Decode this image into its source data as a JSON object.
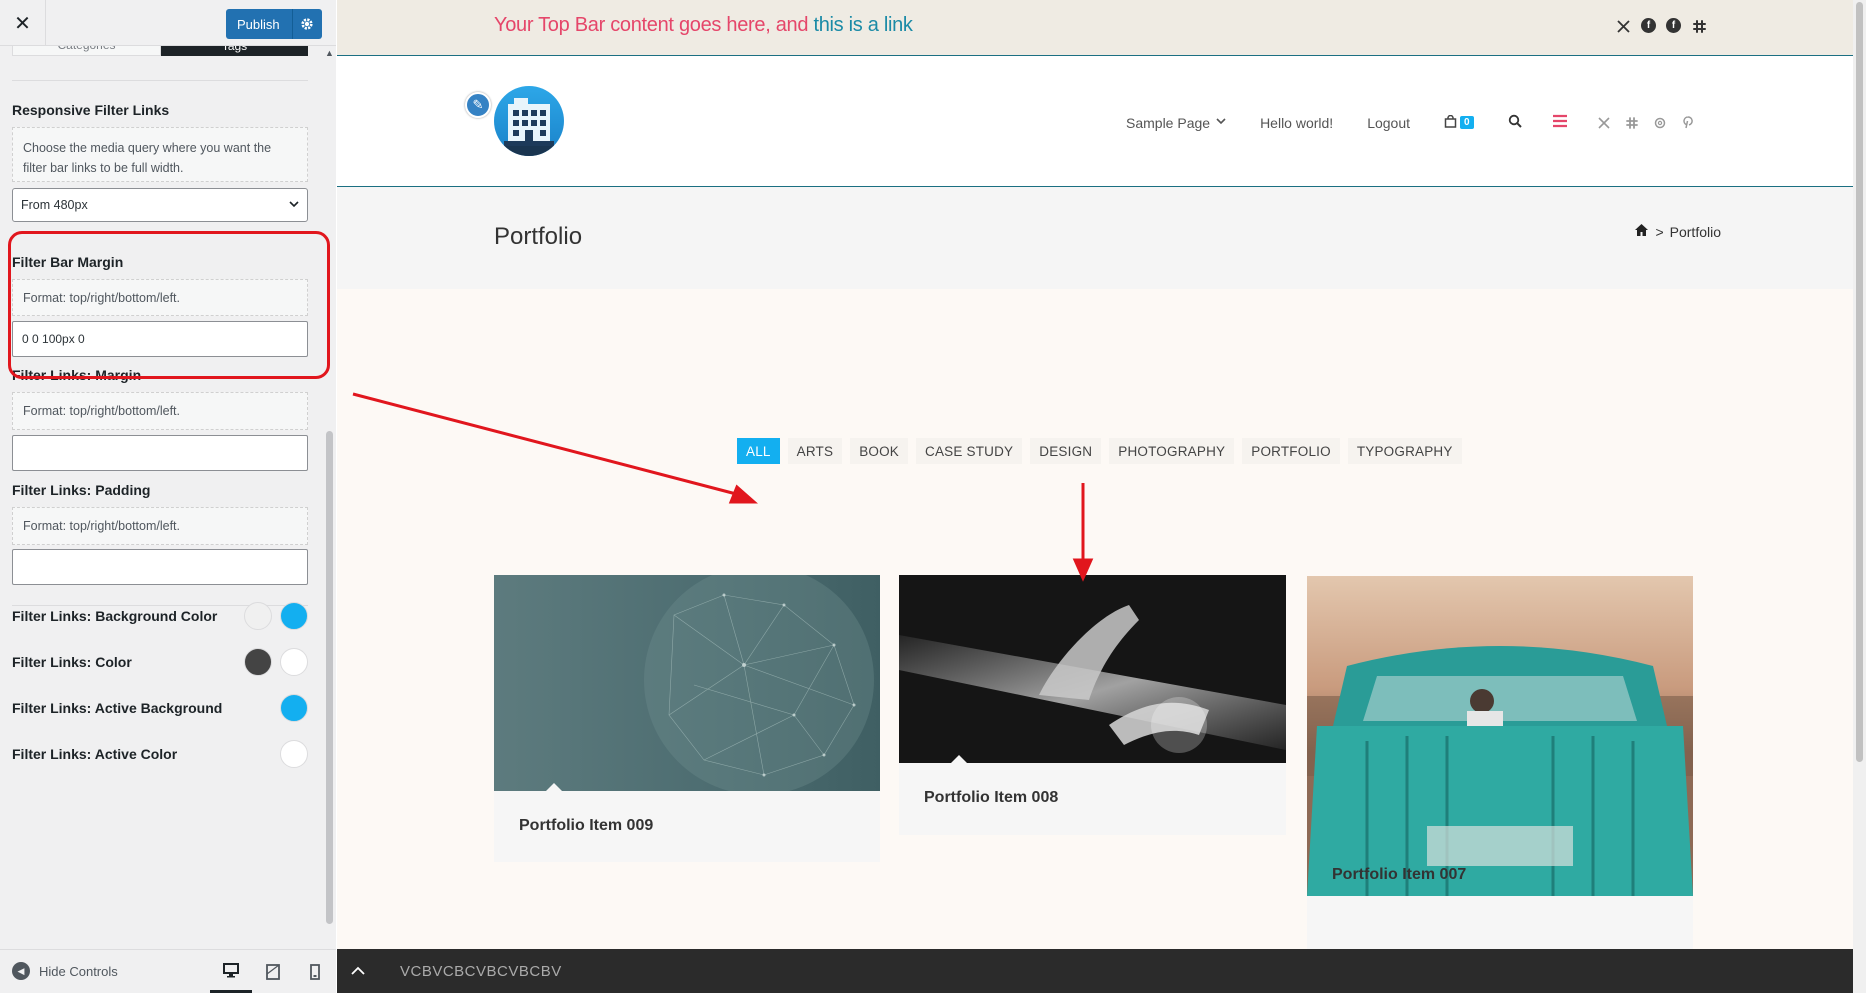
{
  "customizer": {
    "close_label": "✕",
    "publish_label": "Publish",
    "tabs": [
      "Categories",
      "Tags"
    ],
    "sections": {
      "responsive": {
        "title": "Responsive Filter Links",
        "description": "Choose the media query where you want the filter bar links to be full width.",
        "select_value": "From 480px"
      },
      "filter_bar_margin": {
        "title": "Filter Bar Margin",
        "description": "Format: top/right/bottom/left.",
        "value": "0 0 100px 0"
      },
      "links_margin": {
        "title": "Filter Links: Margin",
        "description": "Format: top/right/bottom/left.",
        "value": ""
      },
      "links_padding": {
        "title": "Filter Links: Padding",
        "description": "Format: top/right/bottom/left.",
        "value": ""
      }
    },
    "color_rows": [
      {
        "label": "Filter Links: Background Color",
        "swatches": [
          "#f0f0f0",
          "#13aff0"
        ]
      },
      {
        "label": "Filter Links: Color",
        "swatches": [
          "#444444",
          "#ffffff"
        ]
      },
      {
        "label": "Filter Links: Active Background",
        "swatches": [
          "#13aff0"
        ]
      },
      {
        "label": "Filter Links: Active Color",
        "swatches": [
          "#ffffff"
        ]
      }
    ],
    "footer": {
      "hide_controls_label": "Hide Controls",
      "devices": [
        "desktop-icon",
        "tablet-icon",
        "mobile-icon"
      ],
      "active_device": "desktop"
    }
  },
  "preview": {
    "topbar": {
      "text": "Your Top Bar content goes here, and ",
      "link_text": "this is a link",
      "social_icons": [
        "x-icon",
        "facebook-icon",
        "facebook-icon",
        "slack-icon"
      ]
    },
    "nav": {
      "items": [
        {
          "label": "Sample Page",
          "has_dropdown": true
        },
        {
          "label": "Hello world!",
          "has_dropdown": false
        },
        {
          "label": "Logout",
          "has_dropdown": false
        }
      ],
      "cart_count": "0",
      "social_icons": [
        "x-icon",
        "slack-icon",
        "threads-icon",
        "pinterest-icon"
      ]
    },
    "page_title": "Portfolio",
    "breadcrumb": {
      "home_icon": "home-icon",
      "separator": ">",
      "current": "Portfolio"
    },
    "filters": [
      "ALL",
      "ARTS",
      "BOOK",
      "CASE STUDY",
      "DESIGN",
      "PHOTOGRAPHY",
      "PORTFOLIO",
      "TYPOGRAPHY"
    ],
    "active_filter": "ALL",
    "portfolio_items": [
      {
        "title": "Portfolio Item 009"
      },
      {
        "title": "Portfolio Item 008"
      },
      {
        "title": "Portfolio Item 007"
      }
    ],
    "bottom_bar": {
      "text": "VCBVCBCVBCVBCBV"
    }
  },
  "colors": {
    "accent": "#13aff0",
    "annotation": "#e1161d",
    "topbar_text": "#e5466a",
    "topbar_link": "#1a8aa6",
    "wp_blue": "#2271b1"
  }
}
